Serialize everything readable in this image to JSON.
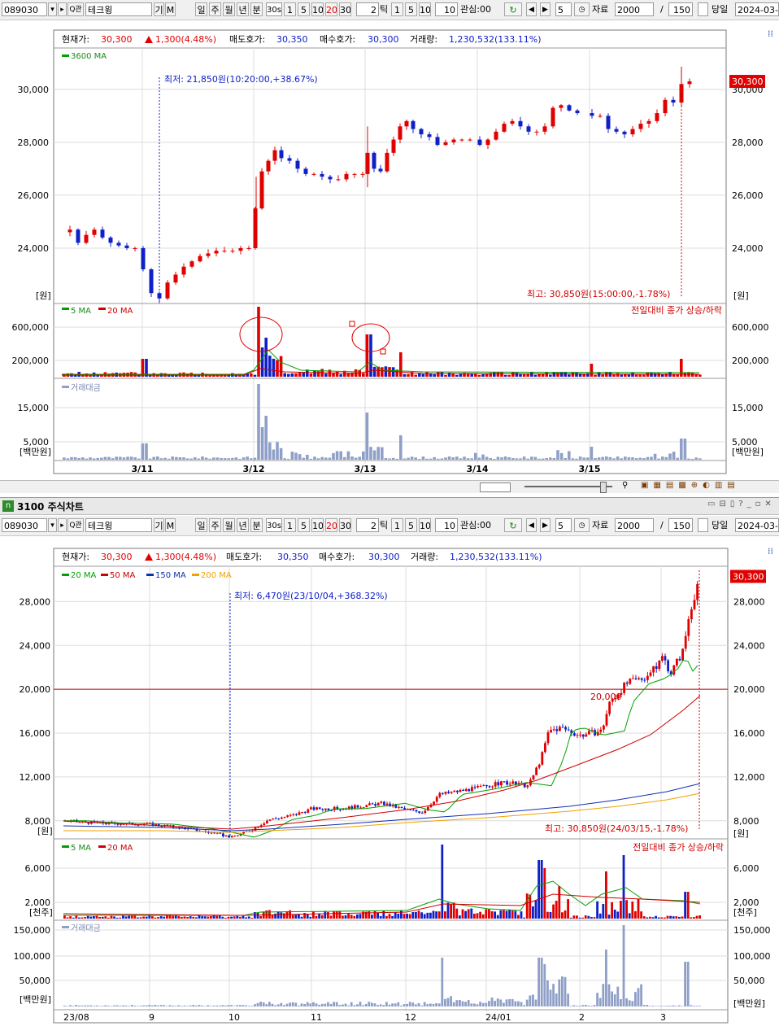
{
  "toolbar": {
    "code": "089030",
    "search_glyph": "Q관",
    "name": "테크윙",
    "gi_label": "기",
    "m_label": "M",
    "period_buttons": [
      "일",
      "주",
      "월",
      "년",
      "분"
    ],
    "period_selected": "분",
    "min_value": "30s",
    "interval_buttons": [
      "1",
      "5",
      "10",
      "20",
      "30"
    ],
    "interval_selected": "20",
    "tick_value": "2",
    "tick_label": "틱",
    "tick_buttons": [
      "1",
      "5",
      "10"
    ],
    "tick_custom": "10",
    "watch_label": "관심:00",
    "step_value": "5",
    "data_label": "자료",
    "data_value": "2000",
    "slash": "/",
    "count_value": "150",
    "day_label": "당일",
    "date_value": "2024-03-"
  },
  "top": {
    "price_info": {
      "current_label": "현재가:",
      "current_value": "30,300",
      "change_value": "1,300(4.48%)",
      "ask_label": "매도호가:",
      "ask_value": "30,350",
      "bid_label": "매수호가:",
      "bid_value": "30,300",
      "volume_label": "거래량:",
      "volume_value": "1,230,532(133.11%)"
    },
    "price_legend": "3600 MA",
    "price_tag": "30,300",
    "low_annotation": "최저: 21,850원(10:20:00,+38.67%)",
    "high_annotation": "최고: 30,850원(15:00:00,-1.78%)",
    "unit_won": "[원]",
    "vol_legend_5": "5 MA",
    "vol_legend_20": "20 MA",
    "vol_note": "전일대비 종가 상승/하락",
    "amount_legend": "거래대금",
    "unit_million": "[백만원]"
  },
  "bottom_window": {
    "title": "3100 주식차트",
    "price_legend": [
      "20 MA",
      "50 MA",
      "150 MA",
      "200 MA"
    ],
    "price_tag": "30,300",
    "low_annotation": "최저: 6,470원(23/10/04,+368.32%)",
    "high_annotation": "최고: 30,850원(24/03/15,-1.78%)",
    "hline_label": "20,000",
    "unit_won": "[원]",
    "vol_legend_5": "5 MA",
    "vol_legend_20": "20 MA",
    "vol_note": "전일대비 종가 상승/하락",
    "unit_thousand": "[천주]",
    "amount_legend": "거래대금",
    "unit_million": "[백만원]"
  },
  "chart_data": [
    {
      "type": "candlestick",
      "title": "",
      "period": "intraday",
      "x_dates": [
        "3/11",
        "3/12",
        "3/13",
        "3/14",
        "3/15"
      ],
      "y_ticks": [
        "24,000",
        "26,000",
        "28,000",
        "30,000"
      ],
      "ylim": [
        22000,
        31500
      ],
      "segments": [
        {
          "day": "3/11",
          "open": 24600,
          "high": 24800,
          "low": 21850,
          "close": 23900
        },
        {
          "day": "3/12",
          "open": 26600,
          "high": 28000,
          "low": 25400,
          "close": 26700
        },
        {
          "day": "3/13",
          "open": 26500,
          "high": 29200,
          "low": 26400,
          "close": 28200
        },
        {
          "day": "3/14",
          "open": 28000,
          "high": 29500,
          "low": 27400,
          "close": 28900
        },
        {
          "day": "3/15",
          "open": 28900,
          "high": 30850,
          "low": 27900,
          "close": 30300
        }
      ],
      "volume_y_ticks": [
        "200,000",
        "600,000"
      ],
      "amount_y_ticks": [
        "5,000",
        "15,000"
      ]
    },
    {
      "type": "candlestick",
      "title": "",
      "period": "daily",
      "x_months": [
        "23/08",
        "9",
        "10",
        "11",
        "12",
        "24/01",
        "2",
        "3"
      ],
      "y_ticks": [
        "8,000",
        "12,000",
        "16,000",
        "20,000",
        "24,000",
        "28,000"
      ],
      "ylim": [
        6500,
        31000
      ],
      "price_path": [
        {
          "month": "23/08",
          "close": 8000
        },
        {
          "month": "9",
          "close": 7600
        },
        {
          "month": "10",
          "close": 6470
        },
        {
          "month": "10",
          "close": 8500
        },
        {
          "month": "11",
          "close": 9200
        },
        {
          "month": "12",
          "close": 9000
        },
        {
          "month": "12",
          "close": 10800
        },
        {
          "month": "24/01",
          "close": 11800
        },
        {
          "month": "24/01",
          "close": 16500
        },
        {
          "month": "2",
          "close": 15500
        },
        {
          "month": "2",
          "close": 19500
        },
        {
          "month": "3",
          "close": 21500
        },
        {
          "month": "3",
          "close": 30300
        }
      ],
      "hline": 20000,
      "volume_y_ticks": [
        "2,000",
        "6,000"
      ],
      "amount_y_ticks": [
        "50,000",
        "100,000",
        "150,000"
      ]
    }
  ],
  "colors": {
    "up": "#e00000",
    "down": "#1020c8",
    "ma5": "#00a000",
    "ma20": "#d00000",
    "ma150": "#1030b0",
    "ma200": "#f0a000",
    "grid": "#dcdcdc",
    "amount": "#8f9fc8"
  }
}
